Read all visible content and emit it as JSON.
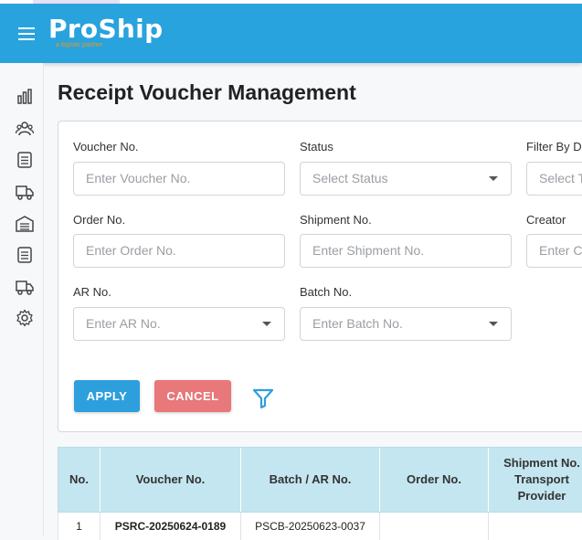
{
  "header": {
    "logo_text": "ProShip",
    "logo_tagline": "a logistic partner",
    "menu_icon": "hamburger-icon",
    "brand_color": "#29a3dd"
  },
  "sidebar": {
    "icons": [
      "chart-icon",
      "users-icon",
      "list-icon",
      "truck-icon",
      "warehouse-icon",
      "list-icon",
      "truck-icon",
      "gear-icon"
    ]
  },
  "page": {
    "title": "Receipt Voucher Management"
  },
  "filters": {
    "voucher_no": {
      "label": "Voucher No.",
      "placeholder": "Enter Voucher No."
    },
    "status": {
      "label": "Status",
      "placeholder": "Select Status"
    },
    "filter_by_date": {
      "label": "Filter By Da",
      "placeholder": "Select T"
    },
    "order_no": {
      "label": "Order No.",
      "placeholder": "Enter Order No."
    },
    "shipment_no": {
      "label": "Shipment No.",
      "placeholder": "Enter Shipment No."
    },
    "creator": {
      "label": "Creator",
      "placeholder": "Enter Cr"
    },
    "ar_no": {
      "label": "AR No.",
      "placeholder": "Enter AR No."
    },
    "batch_no": {
      "label": "Batch No.",
      "placeholder": "Enter Batch No."
    },
    "apply_label": "APPLY",
    "cancel_label": "CANCEL",
    "apply_color": "#2d9fdc",
    "cancel_color": "#e8787a"
  },
  "table": {
    "columns": [
      "No.",
      "Voucher No.",
      "Batch / AR No.",
      "Order No.",
      "Shipment No.\nTransport\nProvider"
    ],
    "rows": [
      [
        "1",
        "PSRC-20250624-0189",
        "PSCB-20250623-0037",
        "",
        ""
      ]
    ]
  }
}
